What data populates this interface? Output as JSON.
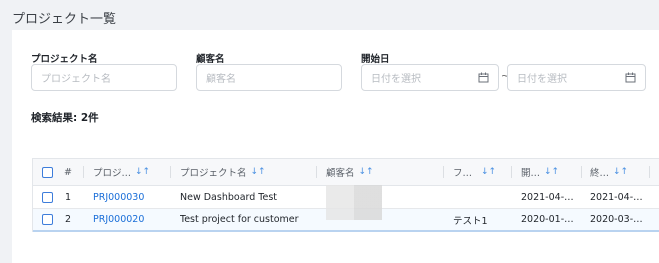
{
  "page": {
    "title": "プロジェクト一覧"
  },
  "search": {
    "project_name": {
      "label": "プロジェクト名",
      "placeholder": "プロジェクト名"
    },
    "client_name": {
      "label": "顧客名",
      "placeholder": "顧客名"
    },
    "start_date": {
      "label": "開始日",
      "from_placeholder": "日付を選択",
      "to_placeholder": "日付を選択",
      "separator": "~"
    },
    "result_text": "検索結果: 2件"
  },
  "table": {
    "headers": [
      "#",
      "プロジ…",
      "プロジェクト名",
      "顧客名",
      "フ…",
      "開…",
      "終…"
    ],
    "sort_glyph": "↓↑",
    "rows": [
      {
        "index": "1",
        "code": "PRJ000030",
        "name": "New Dashboard Test",
        "client": "",
        "f": "",
        "start": "2021-04-…",
        "end": "2021-04-…"
      },
      {
        "index": "2",
        "code": "PRJ000020",
        "name": "Test project for customer",
        "client": "",
        "f": "テスト1",
        "start": "2020-01-…",
        "end": "2020-03-…"
      }
    ]
  },
  "colors": {
    "accent": "#1a6ed8",
    "checkbox": "#3d7ddb"
  }
}
